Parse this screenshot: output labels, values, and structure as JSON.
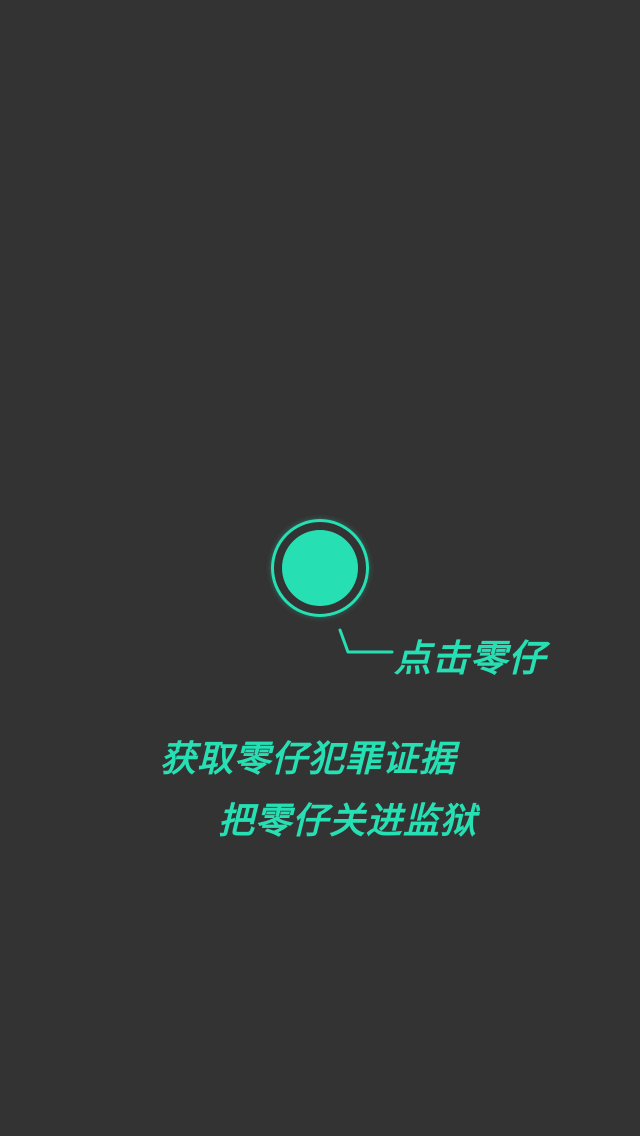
{
  "tap_hint": "点击零仔",
  "mission": {
    "line1": "获取零仔犯罪证据",
    "line2": "把零仔关进监狱"
  },
  "colors": {
    "background": "#333333",
    "accent": "#26e0b4"
  }
}
